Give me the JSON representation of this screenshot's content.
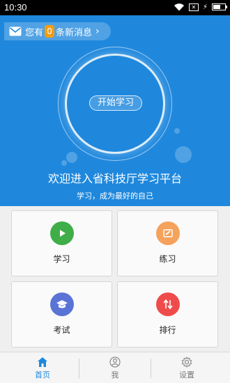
{
  "status_bar": {
    "time": "10:30",
    "battery_level": 0.6
  },
  "hero": {
    "message_prefix": "您有",
    "message_count": "0",
    "message_suffix": "条新消息",
    "start_button": "开始学习",
    "welcome": "欢迎进入省科技厅学习平台",
    "slogan": "学习，成为最好的自己",
    "background_color": "#1f88dd"
  },
  "grid": {
    "items": [
      {
        "label": "学习",
        "icon": "play-icon",
        "color": "#3fae49"
      },
      {
        "label": "练习",
        "icon": "pencil-icon",
        "color": "#f5a25d"
      },
      {
        "label": "考试",
        "icon": "graduation-cap-icon",
        "color": "#5a73d6"
      },
      {
        "label": "排行",
        "icon": "sort-arrows-icon",
        "color": "#f04b4b"
      }
    ]
  },
  "bottom_nav": {
    "items": [
      {
        "label": "首页",
        "icon": "home-icon",
        "active": true
      },
      {
        "label": "我",
        "icon": "user-icon",
        "active": false
      },
      {
        "label": "设置",
        "icon": "gear-icon",
        "active": false
      }
    ]
  }
}
